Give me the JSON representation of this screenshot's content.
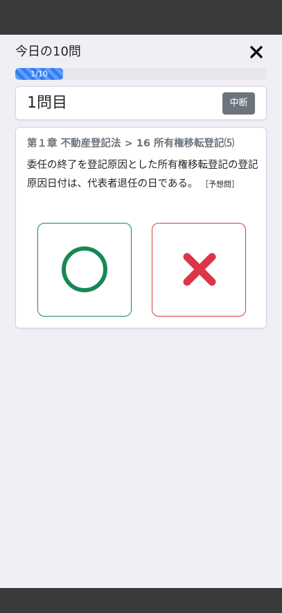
{
  "header": {
    "title": "今日の10問",
    "close_symbol": "✕"
  },
  "progress": {
    "label": "1/10",
    "fraction": 0.1
  },
  "question_card": {
    "number_label": "1問目",
    "suspend_label": "中断"
  },
  "question": {
    "chapter": "第１章 不動産登記法 > 16 所有権移転登記⑸",
    "text": "委任の終了を登記原因とした所有権移転登記の登記原因日付は、代表者退任の日である。",
    "tag": "［予想問］"
  },
  "answers": {
    "true_color": "#198754",
    "false_color": "#dc3545"
  }
}
